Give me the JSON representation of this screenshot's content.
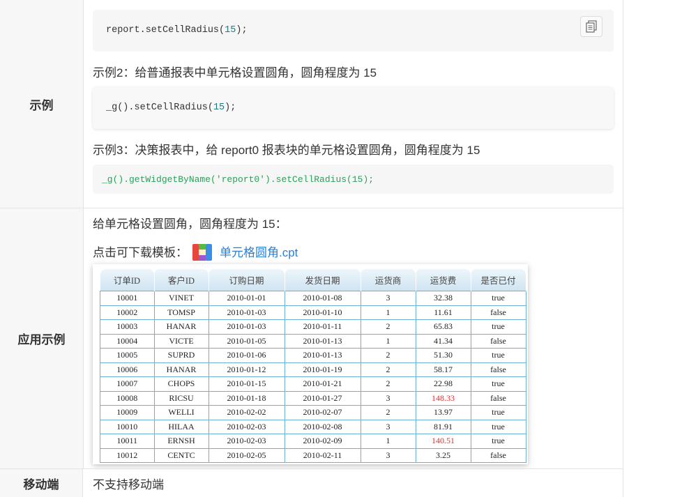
{
  "sections": {
    "example": {
      "label": "示例",
      "code1": "report.setCellRadius(15);",
      "code1_prefix": "report.setCellRadius(",
      "code1_num": "15",
      "code1_suffix": ");",
      "desc2": "示例2：给普通报表中单元格设置圆角，圆角程度为 15",
      "code2_prefix": "_g().setCellRadius(",
      "code2_num": "15",
      "code2_suffix": ");",
      "desc3": "示例3：决策报表中，给 report0 报表块的单元格设置圆角，圆角程度为 15",
      "code3": "_g().getWidgetByName('report0').setCellRadius(15);"
    },
    "application": {
      "label": "应用示例",
      "desc": "给单元格设置圆角，圆角程度为 15：",
      "download_prefix": "点击可下载模板：",
      "download_file": "单元格圆角.cpt"
    },
    "mobile": {
      "label": "移动端",
      "desc": "不支持移动端"
    }
  },
  "report": {
    "columns": [
      "订单ID",
      "客户ID",
      "订购日期",
      "发货日期",
      "运货商",
      "运货费",
      "是否已付"
    ],
    "rows": [
      [
        "10001",
        "VINET",
        "2010-01-01",
        "2010-01-08",
        "3",
        "32.38",
        "true"
      ],
      [
        "10002",
        "TOMSP",
        "2010-01-03",
        "2010-01-10",
        "1",
        "11.61",
        "false"
      ],
      [
        "10003",
        "HANAR",
        "2010-01-03",
        "2010-01-11",
        "2",
        "65.83",
        "true"
      ],
      [
        "10004",
        "VICTE",
        "2010-01-05",
        "2010-01-13",
        "1",
        "41.34",
        "false"
      ],
      [
        "10005",
        "SUPRD",
        "2010-01-06",
        "2010-01-13",
        "2",
        "51.30",
        "true"
      ],
      [
        "10006",
        "HANAR",
        "2010-01-12",
        "2010-01-19",
        "2",
        "58.17",
        "false"
      ],
      [
        "10007",
        "CHOPS",
        "2010-01-15",
        "2010-01-21",
        "2",
        "22.98",
        "true"
      ],
      [
        "10008",
        "RICSU",
        "2010-01-18",
        "2010-01-27",
        "3",
        "148.33",
        "false"
      ],
      [
        "10009",
        "WELLI",
        "2010-02-02",
        "2010-02-07",
        "2",
        "13.97",
        "true"
      ],
      [
        "10010",
        "HILAA",
        "2010-02-03",
        "2010-02-08",
        "3",
        "81.91",
        "true"
      ],
      [
        "10011",
        "ERNSH",
        "2010-02-03",
        "2010-02-09",
        "1",
        "140.51",
        "true"
      ],
      [
        "10012",
        "CENTC",
        "2010-02-05",
        "2010-02-11",
        "3",
        "3.25",
        "false"
      ]
    ],
    "highlight_color": "#e03030",
    "highlight_cells": [
      "7.5",
      "10.5"
    ],
    "border_color": "#6cb0d8"
  },
  "colors": {
    "link": "#2a7fd4",
    "label_bg": "#f7f7f7",
    "code_bg": "#f6f6f6",
    "code_green": "#2aa05a",
    "code_number": "#1a7a7a"
  },
  "icons": {
    "copy": "copy-icon",
    "file": "cpt-file-icon"
  }
}
